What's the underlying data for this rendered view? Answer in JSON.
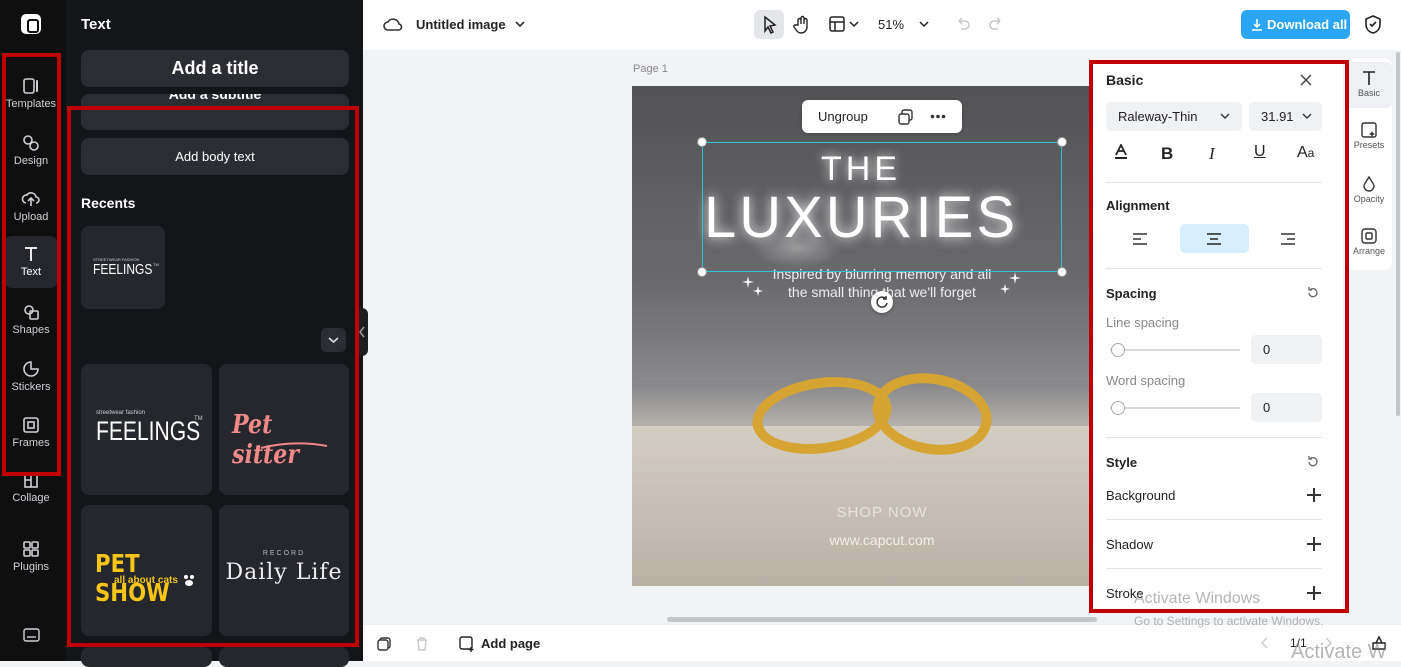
{
  "rail": {
    "items": [
      {
        "label": "Templates",
        "icon": "templates-icon"
      },
      {
        "label": "Design",
        "icon": "design-icon"
      },
      {
        "label": "Upload",
        "icon": "upload-icon"
      },
      {
        "label": "Text",
        "icon": "text-icon"
      },
      {
        "label": "Shapes",
        "icon": "shapes-icon"
      },
      {
        "label": "Stickers",
        "icon": "stickers-icon"
      },
      {
        "label": "Frames",
        "icon": "frames-icon"
      },
      {
        "label": "Collage",
        "icon": "collage-icon"
      },
      {
        "label": "Plugins",
        "icon": "plugins-icon"
      }
    ],
    "active": "Text"
  },
  "panel": {
    "title": "Text",
    "add_title": "Add a title",
    "add_subtitle": "Add a subtitle",
    "add_body": "Add body text",
    "recents": "Recents",
    "recent_tile": {
      "small": "STREETWEAR FASHION",
      "big": "FEELINGS",
      "tm": "TM"
    },
    "tiles": [
      {
        "small": "streetwear fashion",
        "big": "FEELINGS",
        "tm": "TM"
      },
      {
        "big": "Pet sitter"
      },
      {
        "big": "PET SHOW",
        "small": "all about cats"
      },
      {
        "small": "RECORD",
        "big": "Daily Life"
      }
    ]
  },
  "topbar": {
    "file_name": "Untitled image",
    "zoom": "51%",
    "download_label": "Download all"
  },
  "canvas": {
    "page_label": "Page 1",
    "ungroup": "Ungroup",
    "the": "THE",
    "luxuries": "LUXURIES",
    "tagline_1": "Inspired by blurring memory and all",
    "tagline_2": "the small thing that we'll forget",
    "shop_now": "SHOP NOW",
    "website": "www.capcut.com"
  },
  "props": {
    "section": "Basic",
    "font": "Raleway-Thin",
    "font_size": "31.91",
    "alignment_label": "Alignment",
    "spacing_label": "Spacing",
    "line_spacing_label": "Line spacing",
    "line_spacing_value": "0",
    "word_spacing_label": "Word spacing",
    "word_spacing_value": "0",
    "style_label": "Style",
    "background_label": "Background",
    "shadow_label": "Shadow",
    "stroke_label": "Stroke"
  },
  "rightrail": {
    "items": [
      {
        "label": "Basic",
        "icon": "text-style-icon"
      },
      {
        "label": "Presets",
        "icon": "presets-icon"
      },
      {
        "label": "Opacity",
        "icon": "opacity-icon"
      },
      {
        "label": "Arrange",
        "icon": "arrange-icon"
      }
    ]
  },
  "bottombar": {
    "add_page": "Add page",
    "page_count": "1/1"
  },
  "watermark": {
    "line1": "Activate Windows",
    "line2": "Go to Settings to activate Windows.",
    "line3": "Activate W"
  },
  "colors": {
    "accent": "#2aa6f5",
    "highlight": "#c00000",
    "selection": "#2ec4d6"
  }
}
